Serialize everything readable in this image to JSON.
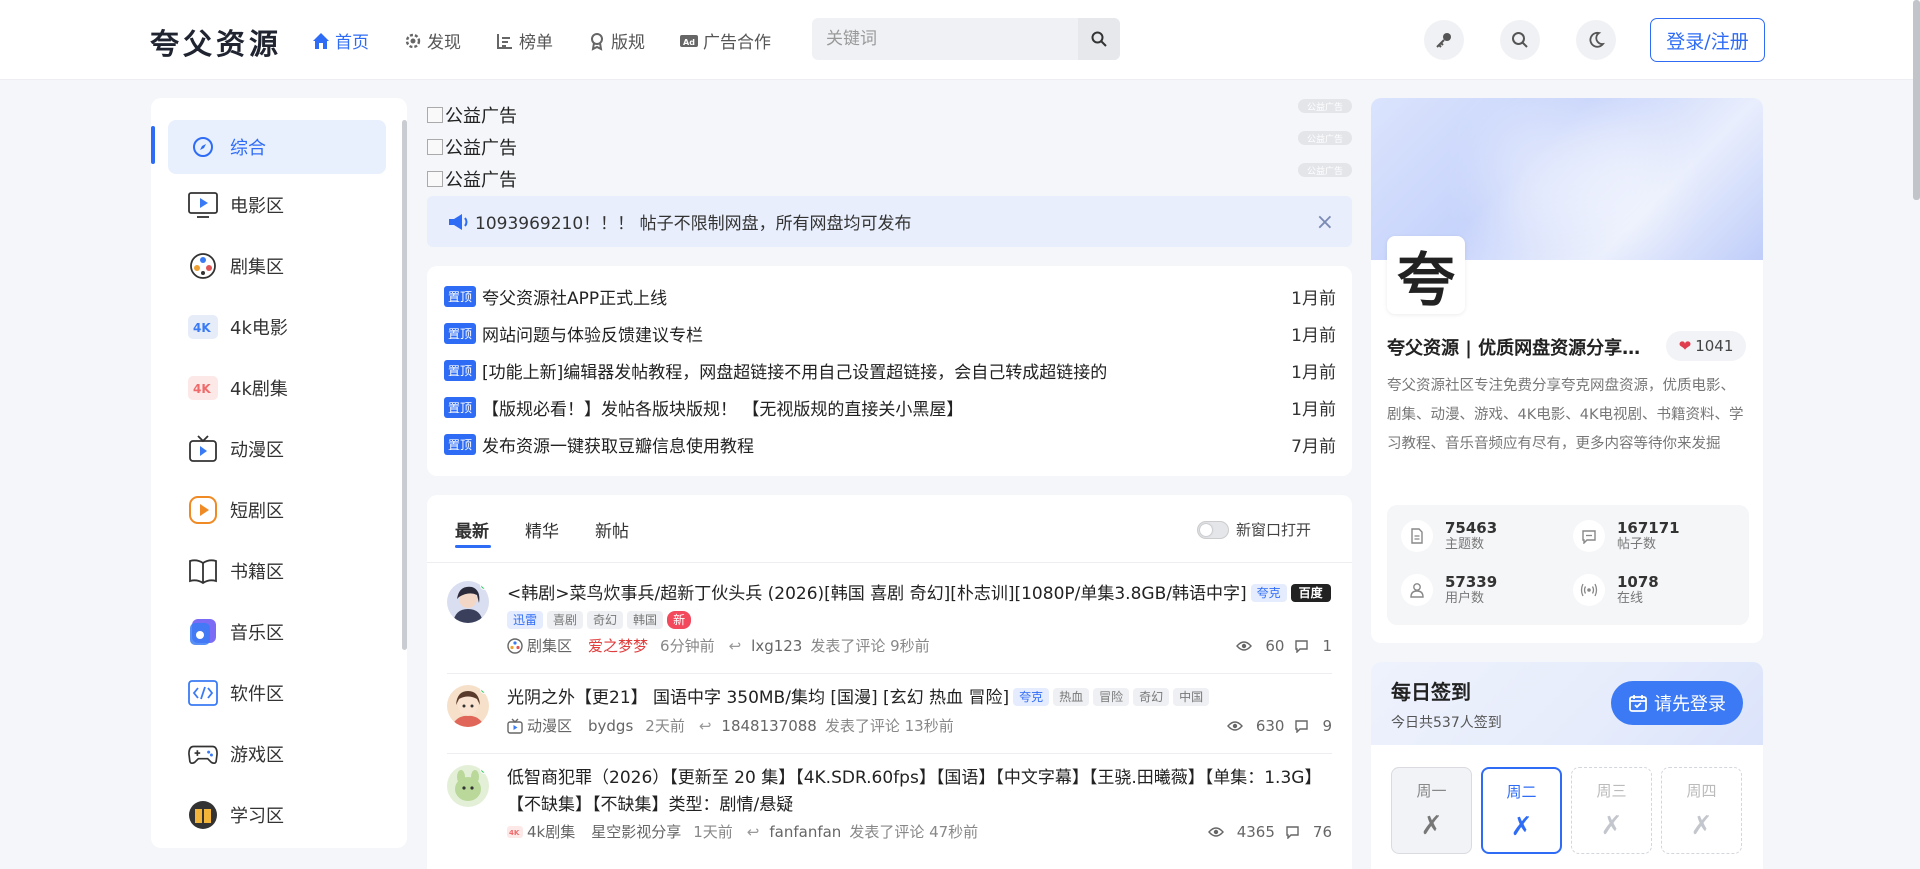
{
  "header": {
    "logo": "夸父资源",
    "nav": [
      {
        "label": "首页",
        "icon": "home-icon"
      },
      {
        "label": "发现",
        "icon": "gear-icon"
      },
      {
        "label": "榜单",
        "icon": "ranking-icon"
      },
      {
        "label": "版规",
        "icon": "award-icon"
      },
      {
        "label": "广告合作",
        "icon": "ad-icon"
      }
    ],
    "search_placeholder": "关键词",
    "login_label": "登录/注册"
  },
  "sidebar": {
    "items": [
      {
        "label": "综合",
        "icon": "compass-icon"
      },
      {
        "label": "电影区",
        "icon": "movie-icon"
      },
      {
        "label": "剧集区",
        "icon": "film-reel-icon"
      },
      {
        "label": "4k电影",
        "icon": "4k-icon"
      },
      {
        "label": "4k剧集",
        "icon": "4k-red-icon"
      },
      {
        "label": "动漫区",
        "icon": "tv-icon"
      },
      {
        "label": "短剧区",
        "icon": "play-icon"
      },
      {
        "label": "书籍区",
        "icon": "book-icon"
      },
      {
        "label": "音乐区",
        "icon": "music-icon"
      },
      {
        "label": "软件区",
        "icon": "code-icon"
      },
      {
        "label": "游戏区",
        "icon": "gamepad-icon"
      },
      {
        "label": "学习区",
        "icon": "study-icon"
      }
    ]
  },
  "ads": {
    "lines": [
      "公益广告",
      "公益广告",
      "公益广告"
    ],
    "tag": "公益广告"
  },
  "notice": {
    "text": "1093969210！！！ 帖子不限制网盘，所有网盘均可发布"
  },
  "pinned": {
    "badge": "置顶",
    "items": [
      {
        "title": "夸父资源社APP正式上线",
        "time": "1月前"
      },
      {
        "title": "网站问题与体验反馈建议专栏",
        "time": "1月前"
      },
      {
        "title": "[功能上新]编辑器发帖教程，网盘超链接不用自己设置超链接，会自己转成超链接的",
        "time": "1月前"
      },
      {
        "title": "【版规必看！】发帖各版块版规！ 【无视版规的直接关小黑屋】",
        "time": "1月前"
      },
      {
        "title": "发布资源一键获取豆瓣信息使用教程",
        "time": "7月前"
      }
    ]
  },
  "feed": {
    "tabs": [
      "最新",
      "精华",
      "新帖"
    ],
    "toggle_label": "新窗口打开",
    "posts": [
      {
        "title": "<韩剧>菜鸟炊事兵/超新丁伙头兵 (2026)[韩国 喜剧 奇幻][朴志训][1080P/单集3.8GB/韩语中字]",
        "tags_inline": [
          "夸克",
          "百度"
        ],
        "tags_line2": [
          "迅雷",
          "喜剧",
          "奇幻",
          "韩国",
          "新"
        ],
        "category": "剧集区",
        "author": "爱之梦梦",
        "time": "6分钟前",
        "replier": "lxg123",
        "reply_text": "发表了评论 9秒前",
        "views": "60",
        "comments": "1"
      },
      {
        "title": "光阴之外【更21】 国语中字 350MB/集均 [国漫] [玄幻 热血 冒险]",
        "tags_inline": [
          "夸克",
          "热血",
          "冒险",
          "奇幻",
          "中国"
        ],
        "category": "动漫区",
        "author": "bydgs",
        "time": "2天前",
        "replier": "1848137088",
        "reply_text": "发表了评论 13秒前",
        "views": "630",
        "comments": "9"
      },
      {
        "title": "低智商犯罪（2026）【更新至 20 集】【4K.SDR.60fps】【国语】【中文字幕】【王骁.田曦薇】【单集：1.3G】【不缺集】【不缺集】类型：剧情/悬疑",
        "category": "4k剧集",
        "author": "星空影视分享",
        "time": "1天前",
        "replier": "fanfanfan",
        "reply_text": "发表了评论 47秒前",
        "views": "4365",
        "comments": "76"
      }
    ]
  },
  "profile": {
    "logo_char": "夸",
    "name": "夸父资源 | 优质网盘资源分享社区...",
    "likes": "1041",
    "description": "夸父资源社区专注免费分享夸克网盘资源，优质电影、剧集、动漫、游戏、4K电影、4K电视剧、书籍资料、学习教程、音乐音频应有尽有，更多内容等待你来发掘",
    "stats": [
      {
        "num": "75463",
        "label": "主题数",
        "icon": "document-icon"
      },
      {
        "num": "167171",
        "label": "帖子数",
        "icon": "comment-icon"
      },
      {
        "num": "57339",
        "label": "用户数",
        "icon": "users-icon"
      },
      {
        "num": "1078",
        "label": "在线",
        "icon": "broadcast-icon"
      }
    ]
  },
  "signin": {
    "title": "每日签到",
    "subtitle": "今日共537人签到",
    "button": "请先登录",
    "days": [
      {
        "name": "周一",
        "mark": "✗",
        "state": "done"
      },
      {
        "name": "周二",
        "mark": "✗",
        "state": "today"
      },
      {
        "name": "周三",
        "mark": "✗",
        "state": "future"
      },
      {
        "name": "周四",
        "mark": "✗",
        "state": "future"
      }
    ]
  },
  "colors": {
    "accent": "#2f6cf6",
    "page_bg": "#f4f6f9",
    "online_dot": "#3ecf6b",
    "like_heart": "#e03d4f"
  }
}
